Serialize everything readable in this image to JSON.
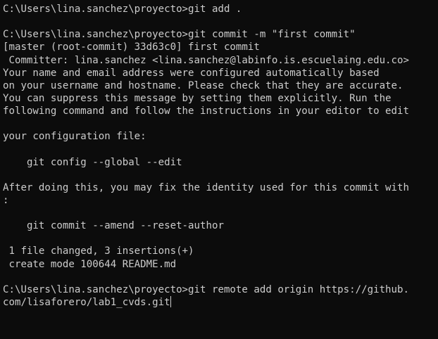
{
  "terminal": {
    "lines": [
      "C:\\Users\\lina.sanchez\\proyecto>git add .",
      "",
      "C:\\Users\\lina.sanchez\\proyecto>git commit -m \"first commit\"",
      "[master (root-commit) 33d63c0] first commit",
      " Committer: lina.sanchez <lina.sanchez@labinfo.is.escuelaing.edu.co>",
      "Your name and email address were configured automatically based",
      "on your username and hostname. Please check that they are accurate.",
      "You can suppress this message by setting them explicitly. Run the",
      "following command and follow the instructions in your editor to edit",
      "your configuration file:",
      "",
      "    git config --global --edit",
      "",
      "After doing this, you may fix the identity used for this commit with:",
      "",
      "    git commit --amend --reset-author",
      "",
      " 1 file changed, 3 insertions(+)",
      " create mode 100644 README.md",
      "",
      "C:\\Users\\lina.sanchez\\proyecto>git remote add origin https://github.com/lisaforero/lab1_cvds.git"
    ],
    "colors": {
      "background": "#0c0c0c",
      "foreground": "#cccccc"
    }
  }
}
